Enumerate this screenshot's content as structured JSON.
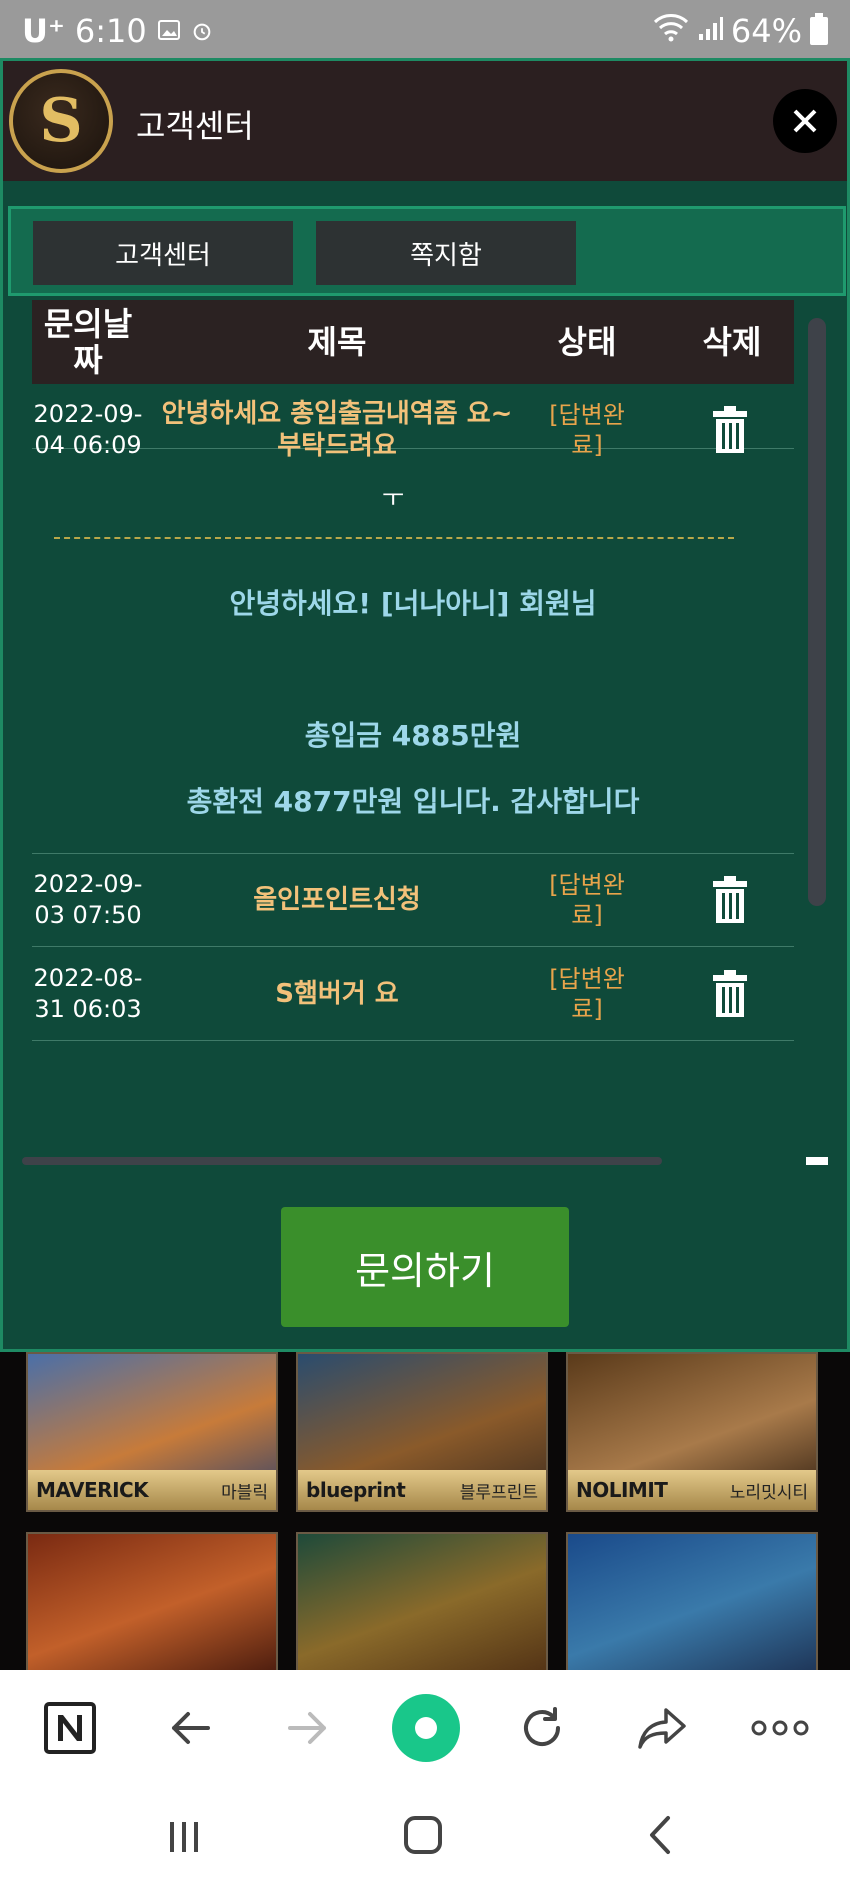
{
  "status_bar": {
    "carrier": "U⁺",
    "time": "6:10",
    "battery": "64%"
  },
  "modal": {
    "title": "고객센터",
    "logo_letter": "S"
  },
  "tabs": [
    {
      "label": "고객센터"
    },
    {
      "label": "쪽지함"
    }
  ],
  "table": {
    "headers": {
      "date": "문의날짜",
      "title": "제목",
      "status": "상태",
      "delete": "삭제"
    },
    "rows": [
      {
        "date": "2022-09-04 06:09",
        "title": "안녕하세요 총입출금내역좀 요~ 부탁드려요",
        "status": "[답변완료]"
      },
      {
        "date": "2022-09-03 07:50",
        "title": "올인포인트신청",
        "status": "[답변완료]"
      },
      {
        "date": "2022-08-31 06:03",
        "title": "S햄버거 요",
        "status": "[답변완료]"
      }
    ],
    "expanded": {
      "caret": "ㅜ",
      "answer_greeting": "안녕하세요! [너나아니] 회원님",
      "answer_line1": "총입금 4885만원",
      "answer_line2": "총환전 4877만원 입니다. 감사합니다"
    }
  },
  "inquire_button": "문의하기",
  "gallery": [
    {
      "brand": "MAVERICK",
      "kor": "마블릭"
    },
    {
      "brand": "blueprint",
      "kor": "블루프린트"
    },
    {
      "brand": "NOLIMIT",
      "kor": "노리밋시티"
    }
  ],
  "browser_bar": {
    "tab_icon_letter": "N"
  },
  "icons": [
    "wifi-icon",
    "signal-icon",
    "battery-icon",
    "close-icon",
    "trash-icon",
    "back-icon",
    "forward-icon",
    "refresh-icon",
    "share-icon",
    "more-icon",
    "home-icon"
  ]
}
